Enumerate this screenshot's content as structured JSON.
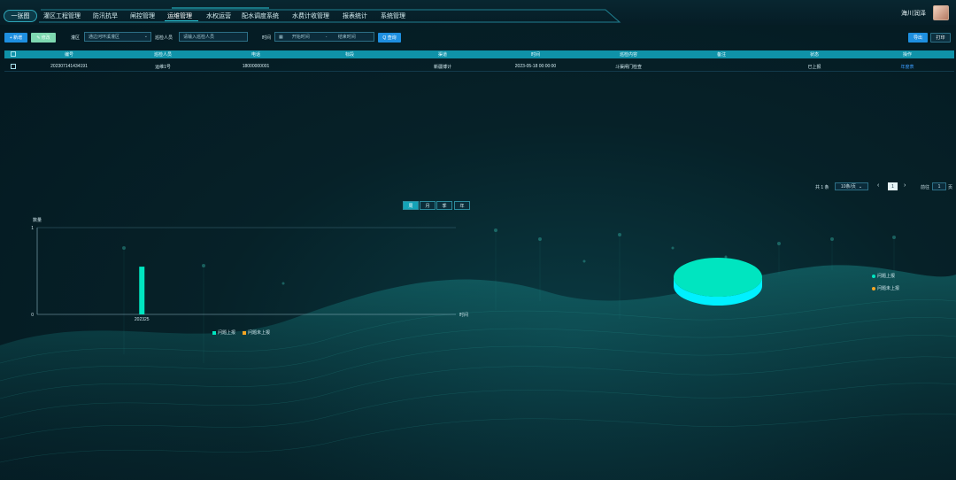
{
  "nav": {
    "home": "一张图",
    "items": [
      "灌区工程管理",
      "防汛抗旱",
      "闸控管理",
      "运维管理",
      "水权运营",
      "配水调度系统",
      "水费计收管理",
      "报表统计",
      "系统管理"
    ],
    "active_index": 3,
    "user_name": "海川润泽"
  },
  "toolbar": {
    "add_label": "+ 新增",
    "edit_label": "✎ 修改",
    "district_label": "灌区",
    "district_value": "通边河环溪灌区",
    "inspector_label": "巡检人员",
    "inspector_placeholder": "请输入巡检人员",
    "time_label": "时间",
    "start_placeholder": "开始时间",
    "range_sep": "-",
    "end_placeholder": "结束时间",
    "search_label": "Q 查询",
    "export_label": "导出",
    "print_label": "打印"
  },
  "table": {
    "columns": [
      "编号",
      "巡检人员",
      "电话",
      "标段",
      "渠道",
      "时间",
      "巡检内容",
      "备注",
      "状态",
      "操作"
    ],
    "rows": [
      {
        "id": "202307141434191",
        "inspector": "运维1号",
        "phone": "18000000001",
        "section": "",
        "channel": "新疆博计",
        "time": "2023-05-18 00:00:00",
        "content": "斗渠闸门检查",
        "remark": "",
        "status": "已上报",
        "action": "年度表"
      }
    ]
  },
  "pagination": {
    "total": "共 1 条",
    "page_size": "10条/页",
    "prev": "‹",
    "current": "1",
    "next": "›",
    "goto_label": "前往",
    "goto_value": "1",
    "page_suffix": "页"
  },
  "period_tabs": [
    "周",
    "月",
    "季",
    "年"
  ],
  "period_active": 0,
  "colors": {
    "teal": "#00e5c0",
    "orange": "#f5a623",
    "accent": "#14a3b7"
  },
  "chart_data": [
    {
      "type": "bar",
      "ylabel": "数量",
      "xlabel": "时间",
      "categories": [
        "202325"
      ],
      "series": [
        {
          "name": "问题上报",
          "values": [
            0.55
          ]
        },
        {
          "name": "问题未上报",
          "values": [
            0
          ]
        }
      ],
      "ylim": [
        0,
        1
      ],
      "y_ticks": [
        "0",
        "1"
      ],
      "grid": false,
      "legend": "bottom"
    },
    {
      "type": "pie",
      "slices": [
        {
          "name": "问题上报",
          "value": 1
        },
        {
          "name": "问题未上报",
          "value": 0
        }
      ],
      "legend": "right"
    }
  ]
}
